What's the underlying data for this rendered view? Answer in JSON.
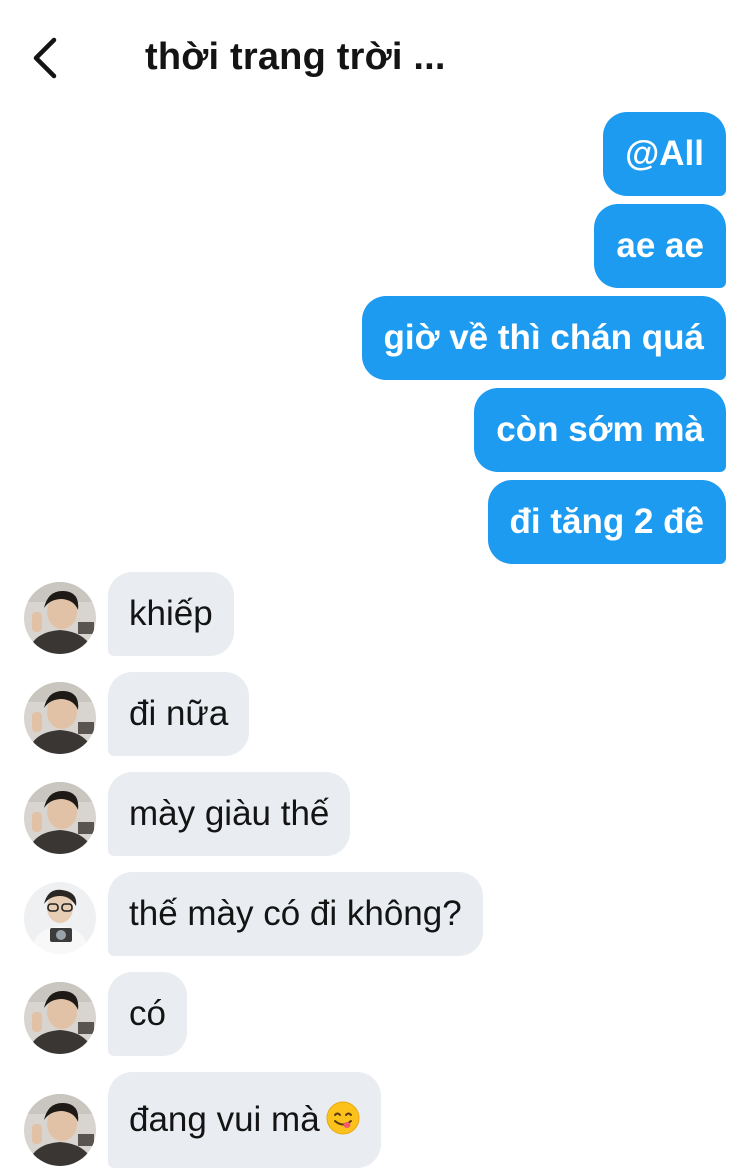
{
  "header": {
    "title": "thời trang trời ..."
  },
  "messages": {
    "outgoing": [
      "@All",
      "ae ae",
      "giờ về thì chán quá",
      "còn sớm mà",
      "đi tăng 2 đê"
    ],
    "incoming": [
      "khiếp",
      "đi nữa",
      "mày giàu thế",
      "thế mày có đi không?",
      "có",
      "đang vui mà"
    ],
    "last_emoji": "savoring-food-emoji"
  },
  "colors": {
    "outgoing_bubble": "#1d9bf0",
    "incoming_bubble": "#e9edf2",
    "text_dark": "#141414"
  }
}
